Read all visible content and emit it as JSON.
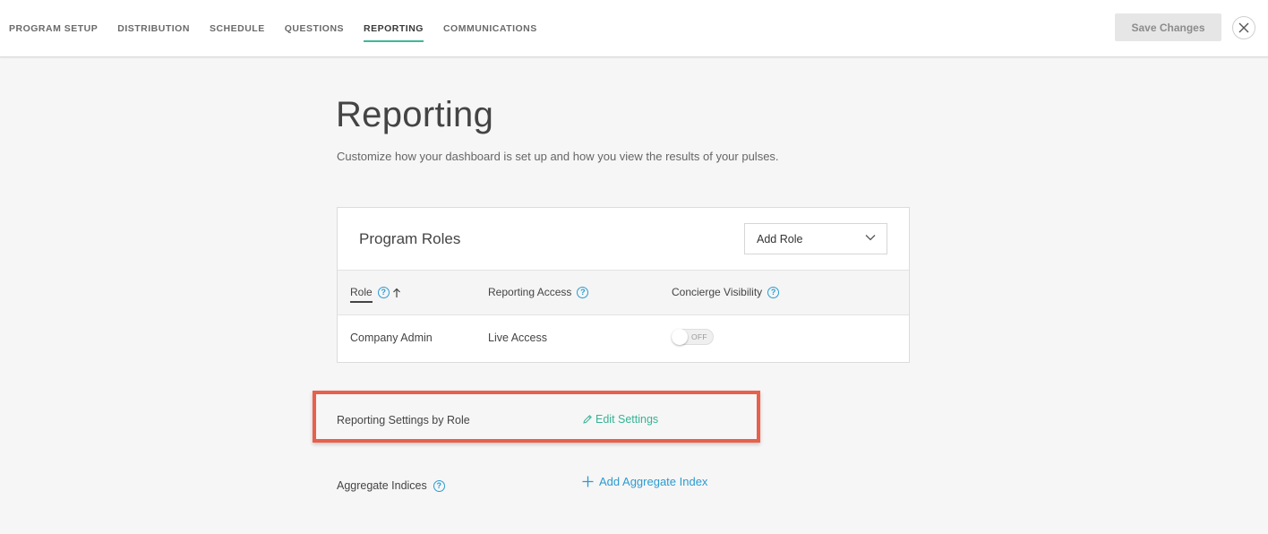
{
  "nav": {
    "items": [
      {
        "label": "PROGRAM SETUP"
      },
      {
        "label": "DISTRIBUTION"
      },
      {
        "label": "SCHEDULE"
      },
      {
        "label": "QUESTIONS"
      },
      {
        "label": "REPORTING",
        "active": true
      },
      {
        "label": "COMMUNICATIONS"
      }
    ]
  },
  "header": {
    "save_label": "Save Changes",
    "close_icon": "close-icon"
  },
  "page": {
    "title": "Reporting",
    "subtitle": "Customize how your dashboard is set up and how you view the results of your pulses."
  },
  "roles_card": {
    "title": "Program Roles",
    "add_role_label": "Add Role",
    "columns": {
      "role": "Role",
      "reporting_access": "Reporting Access",
      "concierge_visibility": "Concierge Visibility"
    },
    "rows": [
      {
        "role": "Company Admin",
        "access": "Live Access",
        "toggle_label": "OFF",
        "toggle_on": false
      }
    ]
  },
  "settings": {
    "label": "Reporting Settings by Role",
    "edit_label": "Edit Settings"
  },
  "aggregate": {
    "label": "Aggregate Indices",
    "add_label": "Add Aggregate Index"
  },
  "colors": {
    "accent_green": "#36b496",
    "link_blue": "#2b9bd1",
    "highlight_red": "#e8604c"
  }
}
